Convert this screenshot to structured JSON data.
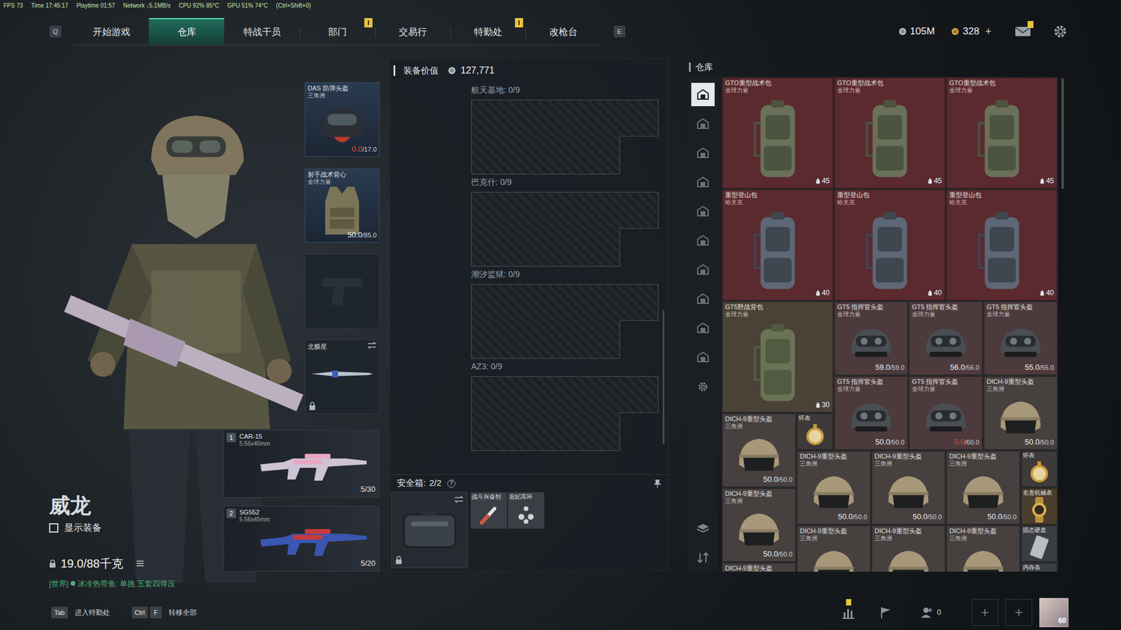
{
  "debug": {
    "fps": "FPS 73",
    "time": "Time 17:45:17",
    "playtime": "Playtime 01:57",
    "network": "Network ↓5.1MB/s",
    "cpu": "CPU 92% 85°C",
    "gpu": "GPU 51% 74°C",
    "hotkey": "(Ctrl+Shift+0)"
  },
  "nav": {
    "left_key": "Q",
    "right_key": "E",
    "tabs": [
      {
        "label": "开始游戏",
        "selected": false,
        "badge": false
      },
      {
        "label": "仓库",
        "selected": true,
        "badge": false
      },
      {
        "label": "特战干员",
        "selected": false,
        "badge": false
      },
      {
        "label": "部门",
        "selected": false,
        "badge": true
      },
      {
        "label": "交易行",
        "selected": false,
        "badge": false
      },
      {
        "label": "特勤处",
        "selected": false,
        "badge": true
      },
      {
        "label": "改枪台",
        "selected": false,
        "badge": false
      }
    ]
  },
  "currency": {
    "coins": "105M",
    "tickets": "328",
    "add": "+"
  },
  "mail": {
    "badge": true
  },
  "operator": {
    "name": "威龙",
    "show_gear": {
      "label": "显示装备",
      "checked": false
    },
    "weight": "19.0/88千克"
  },
  "chat": {
    "channel": "[世界]",
    "message": "冰冷热带鱼: 单挑 五套四弹压"
  },
  "hotkeys": [
    {
      "keys": [
        "Tab"
      ],
      "label": "进入特勤处"
    },
    {
      "keys": [
        "Ctrl",
        "F"
      ],
      "label": "转移全部"
    }
  ],
  "equipment": {
    "helmet": {
      "name": "DAS 防弹头盔",
      "brand": "三角洲",
      "durability": "0.0",
      "max": "/17.0",
      "broken": true
    },
    "armor": {
      "name": "射手战术背心",
      "brand": "全球力量",
      "durability": "50.0",
      "max": "/85.0",
      "broken": false
    },
    "melee": {
      "name": "北极星",
      "locked": true
    },
    "weapons": [
      {
        "slot": "1",
        "name": "CAR-15",
        "caliber": "5.56x45mm",
        "ammo": "5/30"
      },
      {
        "slot": "2",
        "name": "SG552",
        "caliber": "5.56x45mm",
        "ammo": "5/20"
      }
    ]
  },
  "loadout": {
    "value_label": "装备价值",
    "value": "127,771",
    "sections": [
      {
        "label": "航天基地: 0/9"
      },
      {
        "label": "巴克什: 0/9"
      },
      {
        "label": "潮汐监狱: 0/9"
      },
      {
        "label": "AZ3: 0/9"
      }
    ],
    "secure_case": {
      "label": "安全箱:",
      "count": "2/2",
      "help": "?",
      "locked": true,
      "items": [
        {
          "name": "战斗兴奋剂",
          "kind": "stim"
        },
        {
          "name": "后妃耳环",
          "kind": "earring"
        }
      ]
    }
  },
  "warehouse": {
    "title": "仓库",
    "sidebar": [
      {
        "selected": true
      },
      {
        "selected": false
      },
      {
        "selected": false
      },
      {
        "selected": false
      },
      {
        "selected": false
      },
      {
        "selected": false
      },
      {
        "selected": false
      },
      {
        "selected": false
      },
      {
        "selected": false
      },
      {
        "selected": false
      }
    ],
    "items": [
      {
        "kind": "tactical-bag",
        "name": "GTO重型战术包",
        "brand": "全球力量",
        "count": "45",
        "color": "#5b2a2f"
      },
      {
        "kind": "tactical-bag",
        "name": "GTO重型战术包",
        "brand": "全球力量",
        "count": "45",
        "color": "#5b2a2f"
      },
      {
        "kind": "tactical-bag",
        "name": "GTO重型战术包",
        "brand": "全球力量",
        "count": "45",
        "color": "#5b2a2f"
      },
      {
        "kind": "mountain-bag",
        "name": "重型登山包",
        "brand": "哈夫克",
        "count": "40",
        "color": "#5b2a2f"
      },
      {
        "kind": "mountain-bag",
        "name": "重型登山包",
        "brand": "哈夫克",
        "count": "40",
        "color": "#5b2a2f"
      },
      {
        "kind": "mountain-bag",
        "name": "重型登山包",
        "brand": "哈夫克",
        "count": "40",
        "color": "#5b2a2f"
      },
      {
        "kind": "field-bag",
        "name": "GT5野战背包",
        "brand": "全球力量",
        "count": "30",
        "color": "#4a4236"
      },
      {
        "kind": "tactical-helmet",
        "name": "GT5 指挥官头盔",
        "brand": "全球力量",
        "durability": "59.0",
        "max": "/59.0",
        "broken": false,
        "color": "#4d3a3c"
      },
      {
        "kind": "tactical-helmet",
        "name": "GT5 指挥官头盔",
        "brand": "全球力量",
        "durability": "56.0",
        "max": "/56.0",
        "broken": false,
        "color": "#4d3a3c"
      },
      {
        "kind": "tactical-helmet",
        "name": "GT5 指挥官头盔",
        "brand": "全球力量",
        "durability": "55.0",
        "max": "/55.0",
        "broken": false,
        "color": "#4d3a3c"
      },
      {
        "kind": "tactical-helmet",
        "name": "GT5 指挥官头盔",
        "brand": "全球力量",
        "durability": "50.0",
        "max": "/50.0",
        "broken": false,
        "color": "#4d3a3c"
      },
      {
        "kind": "tactical-helmet",
        "name": "GT5 指挥官头盔",
        "brand": "全球力量",
        "durability": "0.0",
        "max": "/60.0",
        "broken": true,
        "color": "#4d3a3c"
      },
      {
        "kind": "heavy-helmet",
        "name": "DICH-9重型头盔",
        "brand": "三角洲",
        "durability": "50.0",
        "max": "/50.0",
        "broken": false,
        "color": "#46403f"
      },
      {
        "kind": "heavy-helmet",
        "name": "DICH-9重型头盔",
        "brand": "三角洲",
        "durability": "50.0",
        "max": "/50.0",
        "broken": false,
        "color": "#46403f"
      },
      {
        "kind": "pocket-watch",
        "name": "怀表",
        "color": "#3d3a39"
      },
      {
        "kind": "heavy-helmet",
        "name": "DICH-9重型头盔",
        "brand": "三角洲",
        "durability": "50.0",
        "max": "/50.0",
        "broken": false,
        "color": "#46403f"
      },
      {
        "kind": "heavy-helmet",
        "name": "DICH-9重型头盔",
        "brand": "三角洲",
        "durability": "50.0",
        "max": "/50.0",
        "broken": false,
        "color": "#46403f"
      },
      {
        "kind": "heavy-helmet",
        "name": "DICH-9重型头盔",
        "brand": "三角洲",
        "durability": "50.0",
        "max": "/50.0",
        "broken": false,
        "color": "#46403f"
      },
      {
        "kind": "pocket-watch",
        "name": "怀表",
        "color": "#3d3a39"
      },
      {
        "kind": "wristwatch",
        "name": "名贵机械表",
        "color": "#4a3d2c"
      },
      {
        "kind": "heavy-helmet",
        "name": "DICH-9重型头盔",
        "brand": "三角洲",
        "durability": "50.0",
        "max": "/50.0",
        "broken": false,
        "color": "#46403f"
      },
      {
        "kind": "heavy-helmet",
        "name": "DICH-9重型头盔",
        "brand": "三角洲",
        "color": "#46403f"
      },
      {
        "kind": "heavy-helmet",
        "name": "DICH-9重型头盔",
        "brand": "三角洲",
        "color": "#46403f"
      },
      {
        "kind": "heavy-helmet",
        "name": "DICH-9重型头盔",
        "brand": "三角洲",
        "color": "#46403f"
      },
      {
        "kind": "ssd",
        "name": "固态硬盘",
        "color": "#3a3d42"
      },
      {
        "kind": "heavy-helmet",
        "name": "DICH-9重型头盔",
        "color": "#46403f"
      },
      {
        "kind": "ram",
        "name": "内存条",
        "color": "#3a3d42"
      }
    ]
  },
  "bottom_bar": {
    "stats_badge": true,
    "friends": "0",
    "level": "60"
  }
}
